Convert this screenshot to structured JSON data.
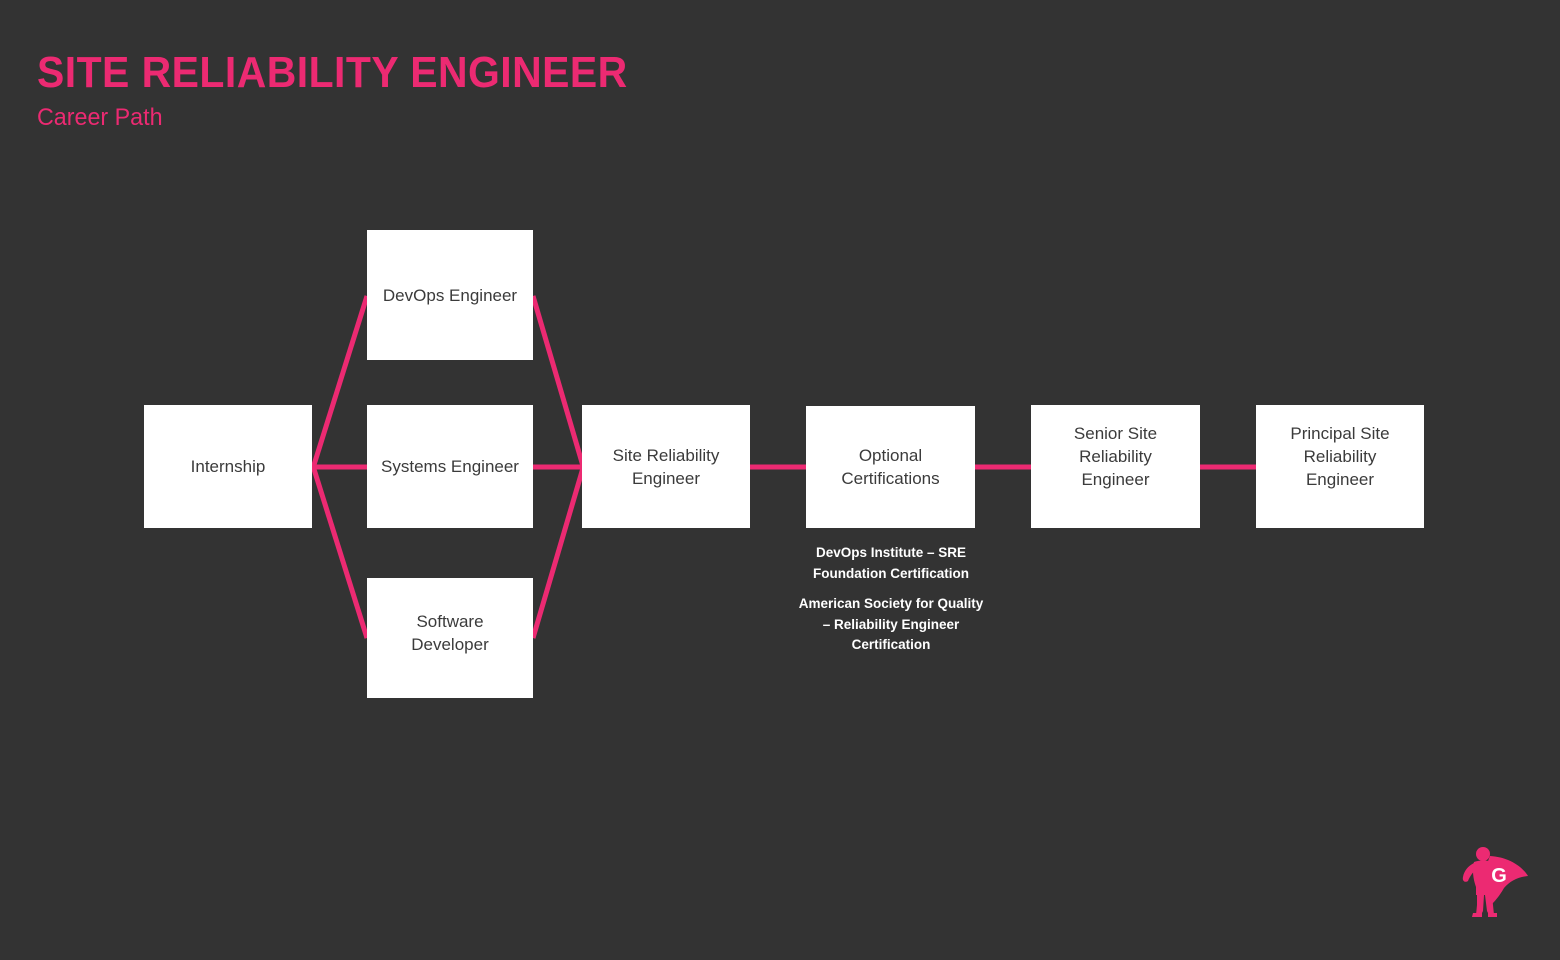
{
  "header": {
    "title": "SITE RELIABILITY ENGINEER",
    "subtitle": "Career Path"
  },
  "colors": {
    "background": "#333333",
    "accent": "#ec2a72",
    "node_fill": "#ffffff",
    "node_text": "#3b3b3b",
    "note_text": "#ffffff"
  },
  "diagram": {
    "type": "career-path-flow",
    "nodes": [
      {
        "id": "internship",
        "label": "Internship"
      },
      {
        "id": "devops",
        "label": "DevOps Engineer"
      },
      {
        "id": "systems",
        "label": "Systems Engineer"
      },
      {
        "id": "software",
        "label": "Software\nDeveloper"
      },
      {
        "id": "sre",
        "label": "Site Reliability\nEngineer"
      },
      {
        "id": "certs",
        "label": "Optional\nCertifications"
      },
      {
        "id": "senior",
        "label": "Senior Site\nReliability\nEngineer"
      },
      {
        "id": "principal",
        "label": "Principal Site\nReliability\nEngineer"
      }
    ],
    "edges": [
      {
        "from": "internship",
        "to": "devops"
      },
      {
        "from": "internship",
        "to": "systems"
      },
      {
        "from": "internship",
        "to": "software"
      },
      {
        "from": "devops",
        "to": "sre"
      },
      {
        "from": "systems",
        "to": "sre"
      },
      {
        "from": "software",
        "to": "sre"
      },
      {
        "from": "sre",
        "to": "certs"
      },
      {
        "from": "certs",
        "to": "senior"
      },
      {
        "from": "senior",
        "to": "principal"
      }
    ]
  },
  "certifications": {
    "items": [
      "DevOps Institute – SRE Foundation Certification",
      "American Society for Quality – Reliability Engineer Certification"
    ]
  },
  "logo": {
    "letter": "G",
    "icon": "superhero-logo"
  }
}
